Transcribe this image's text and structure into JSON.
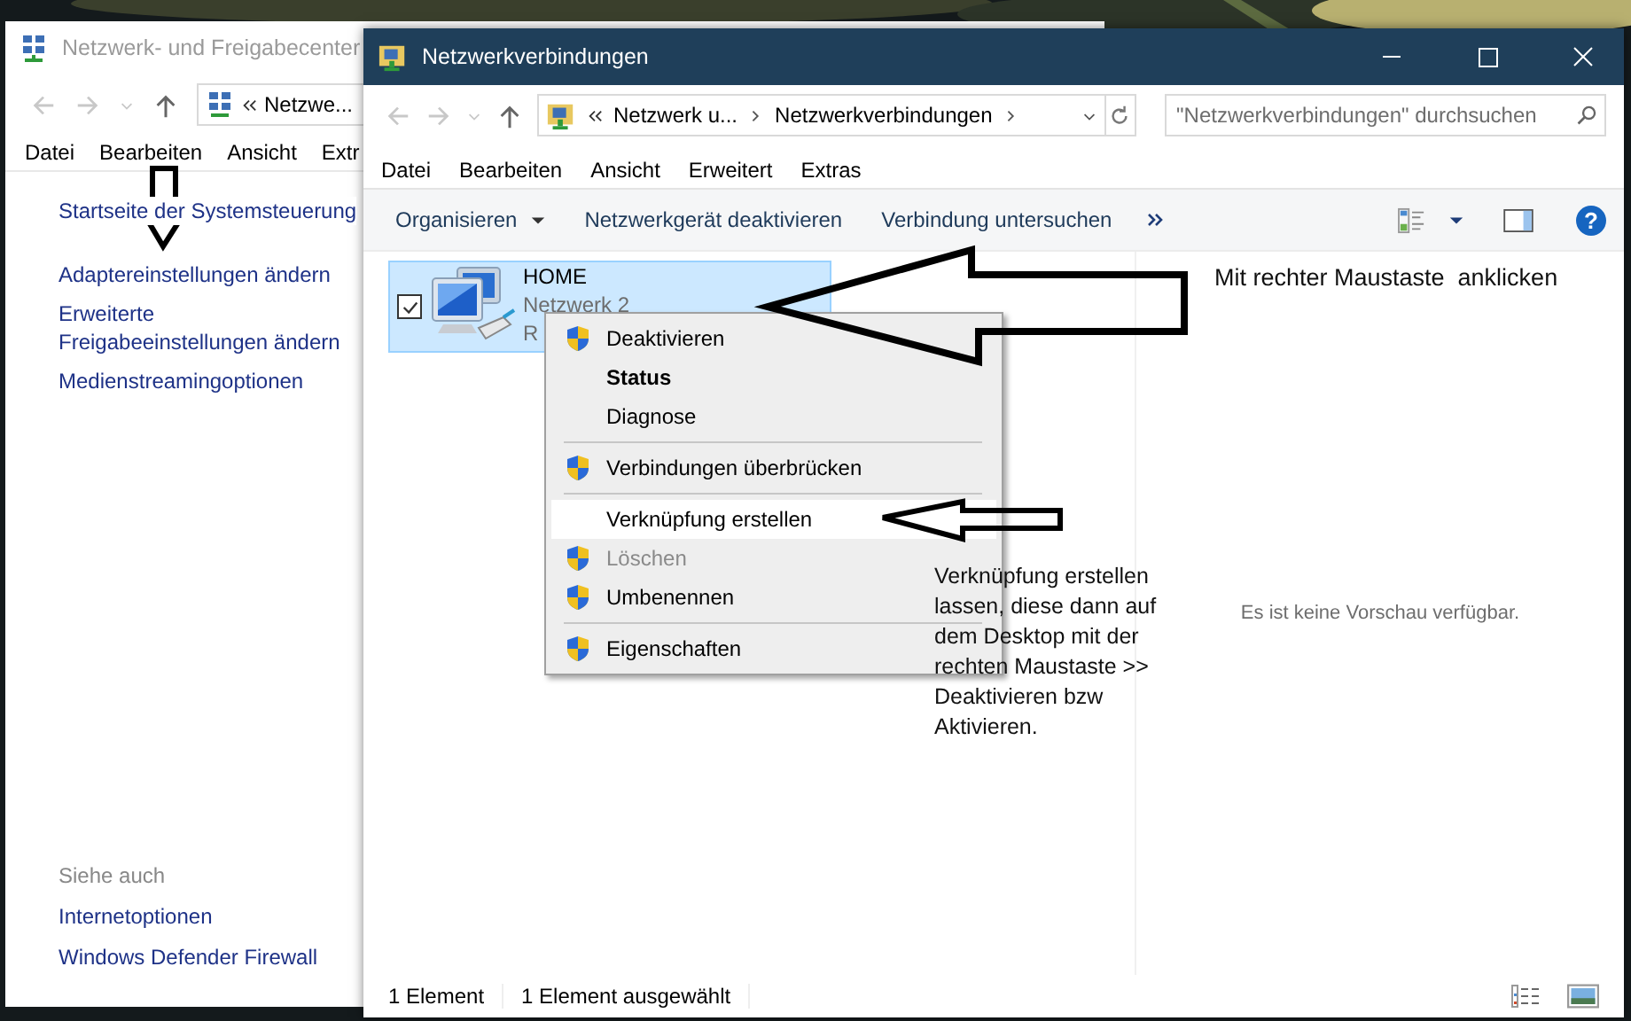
{
  "background_window": {
    "title": "Netzwerk- und Freigabecenter",
    "address": "Netzwe...",
    "menu": [
      "Datei",
      "Bearbeiten",
      "Ansicht",
      "Extr"
    ],
    "links": [
      "Startseite der Systemsteuerung",
      "Adaptereinstellungen ändern",
      "Erweiterte Freigabeeinstellungen ändern",
      "Medienstreamingoptionen"
    ],
    "see_also_heading": "Siehe auch",
    "see_also": [
      "Internetoptionen",
      "Windows Defender Firewall"
    ]
  },
  "window": {
    "title": "Netzwerkverbindungen",
    "breadcrumb": [
      "Netzwerk u...",
      "Netzwerkverbindungen"
    ],
    "search": {
      "placeholder": "\"Netzwerkverbindungen\" durchsuchen"
    },
    "menu": [
      "Datei",
      "Bearbeiten",
      "Ansicht",
      "Erweitert",
      "Extras"
    ],
    "toolbar": [
      {
        "label": "Organisieren",
        "kind": "dropdown"
      },
      {
        "label": "Netzwerkgerät deaktivieren",
        "kind": "button"
      },
      {
        "label": "Verbindung untersuchen",
        "kind": "button"
      }
    ],
    "help_button": "?",
    "connections": [
      {
        "name": "HOME",
        "network": "Netzwerk 2",
        "status": "R",
        "selected": true,
        "checked": true
      }
    ],
    "preview_text": "Es ist keine Vorschau verfügbar.",
    "status_bar": [
      "1 Element",
      "1 Element ausgewählt"
    ]
  },
  "context_menu": [
    {
      "kind": "item",
      "label": "Deaktivieren",
      "shield": true,
      "bold": false,
      "disabled": false,
      "highlighted": false
    },
    {
      "kind": "item",
      "label": "Status",
      "shield": false,
      "bold": true,
      "disabled": false,
      "highlighted": false
    },
    {
      "kind": "item",
      "label": "Diagnose",
      "shield": false,
      "bold": false,
      "disabled": false,
      "highlighted": false
    },
    {
      "kind": "separator"
    },
    {
      "kind": "item",
      "label": "Verbindungen überbrücken",
      "shield": true,
      "bold": false,
      "disabled": false,
      "highlighted": false
    },
    {
      "kind": "separator"
    },
    {
      "kind": "item",
      "label": "Verknüpfung erstellen",
      "shield": false,
      "bold": false,
      "disabled": false,
      "highlighted": true
    },
    {
      "kind": "item",
      "label": "Löschen",
      "shield": true,
      "bold": false,
      "disabled": true,
      "highlighted": false
    },
    {
      "kind": "item",
      "label": "Umbenennen",
      "shield": true,
      "bold": false,
      "disabled": false,
      "highlighted": false
    },
    {
      "kind": "separator"
    },
    {
      "kind": "item",
      "label": "Eigenschaften",
      "shield": true,
      "bold": false,
      "disabled": false,
      "highlighted": false
    }
  ],
  "annotations": [
    {
      "kind": "top",
      "text": "Mit rechter Maustaste  anklicken"
    },
    {
      "kind": "side",
      "text": "Verknüpfung erstellen lassen, diese dann auf dem Desktop mit der rechten Maustaste >> Deaktivieren bzw Aktivieren."
    }
  ]
}
